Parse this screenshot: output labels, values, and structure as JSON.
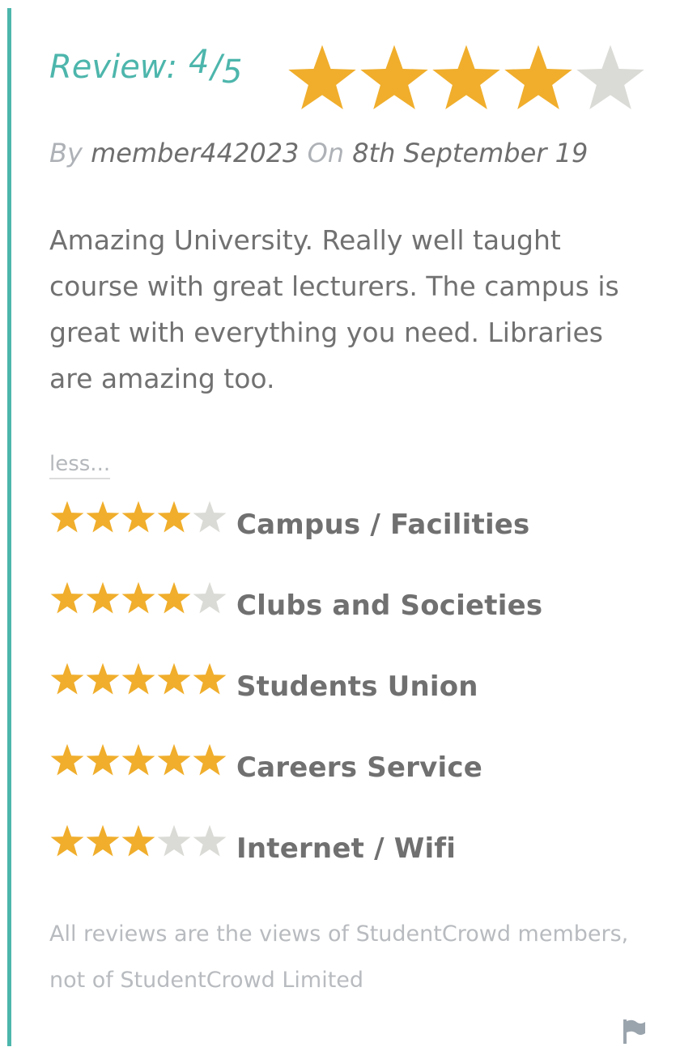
{
  "review": {
    "label": "Review:",
    "score": "4",
    "separator": "/",
    "max": "5",
    "stars_filled": 4,
    "stars_total": 5
  },
  "byline": {
    "by_label": "By",
    "author": "member442023",
    "on_label": "On",
    "date": "8th September 19"
  },
  "body_text": "Amazing University. Really well taught course with great lecturers. The campus is great with everything you need. Libraries are amazing too.",
  "toggle_label": "less...",
  "ratings": [
    {
      "label": "Campus / Facilities",
      "stars": 4
    },
    {
      "label": "Clubs and Societies",
      "stars": 4
    },
    {
      "label": "Students Union",
      "stars": 5
    },
    {
      "label": "Careers Service",
      "stars": 5
    },
    {
      "label": "Internet / Wifi",
      "stars": 3
    }
  ],
  "disclaimer": "All reviews are the views of StudentCrowd members, not of StudentCrowd Limited",
  "icons": {
    "star": "star-icon",
    "flag": "flag-icon"
  },
  "colors": {
    "accent": "#4db6ac",
    "star_filled": "#f0ae2c",
    "star_empty": "#dadad6"
  }
}
